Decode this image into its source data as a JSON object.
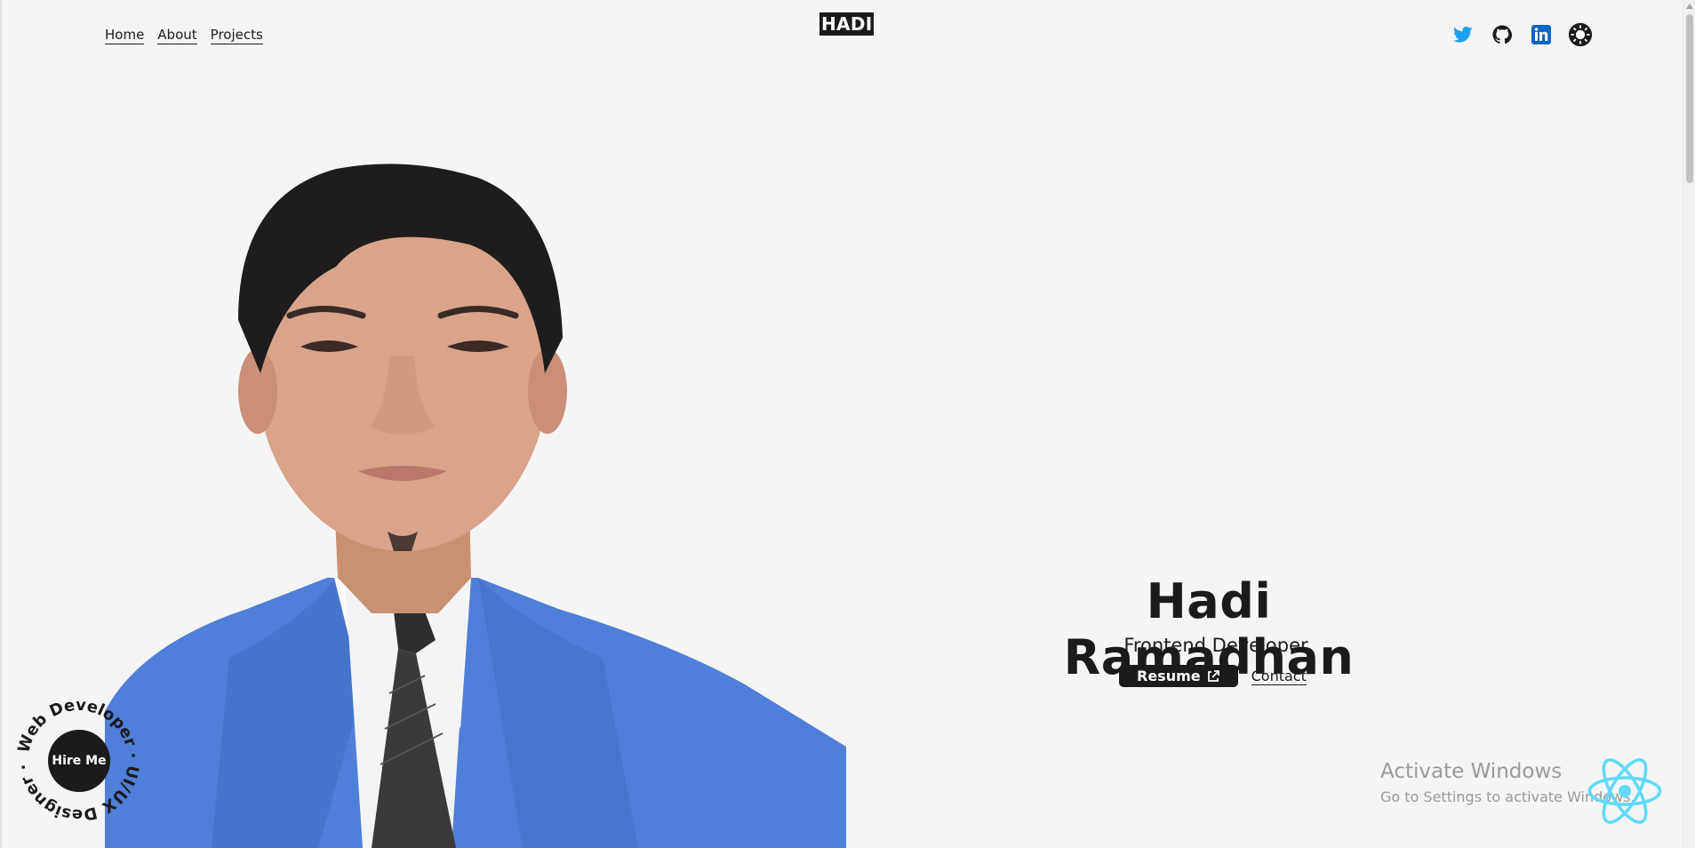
{
  "logo": "HADI",
  "nav": {
    "items": [
      "Home",
      "About",
      "Projects"
    ]
  },
  "social": {
    "icons": [
      "twitter-icon",
      "github-icon",
      "linkedin-icon",
      "theme-toggle-icon"
    ],
    "colors": {
      "twitter": "#1da1f2",
      "linkedin": "#0a66c2",
      "dark": "#1b1b1b"
    }
  },
  "hero": {
    "name": "Hadi Ramadhan",
    "role": "Frontend Developer",
    "resume_label": "Resume",
    "contact_label": "Contact"
  },
  "hire_badge": {
    "button_label": "Hire Me",
    "ring_text": "Web Developer · UI/UX Designer ·"
  },
  "watermark": {
    "line1": "Activate Windows",
    "line2": "Go to Settings to activate Windows."
  },
  "colors": {
    "background": "#f5f5f5",
    "text": "#1b1b1b",
    "react_blue": "#61dafb"
  }
}
